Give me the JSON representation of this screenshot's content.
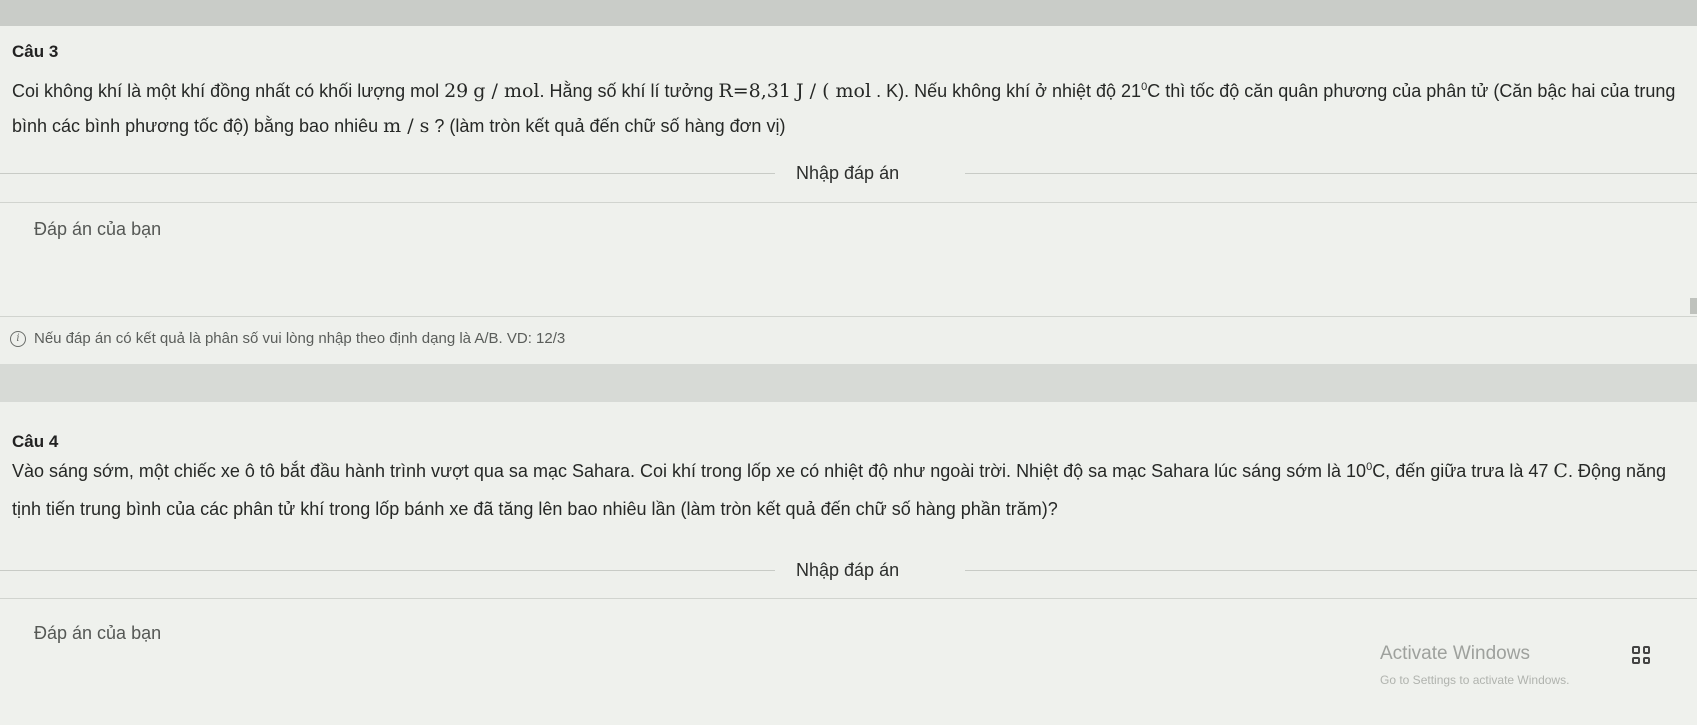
{
  "questions": [
    {
      "title": "Câu 3",
      "text_a": "Coi không khí là một khí đồng nhất có khối lượng mol ",
      "mass": "29",
      "mass_unit": "g / mol",
      "text_b": ". Hằng số khí lí tưởng ",
      "r_symbol": "R",
      "r_value": "=8,31",
      "r_unit": "J / ( mol",
      "text_c": " . K). Nếu không khí ở nhiệt độ ",
      "temp": "21",
      "temp_sup": "0",
      "temp_unit": "C thì tốc độ căn quân phương của phân tử (Căn bậc hai của trung bình các bình phương tốc độ) bằng bao nhiêu ",
      "speed_unit": "m / s",
      "text_d": " ? (làm tròn kết quả đến chữ số hàng đơn vị)",
      "section_label": "Nhập đáp án",
      "answer_placeholder": "Đáp án của bạn",
      "hint": "Nếu đáp án có kết quả là phân số vui lòng nhập theo định dạng là A/B. VD: 12/3"
    },
    {
      "title": "Câu 4",
      "text_a": "Vào sáng sớm, một chiếc xe ô tô bắt đầu hành trình vượt qua sa mạc Sahara. Coi khí trong lốp xe có nhiệt độ như ngoài trời. Nhiệt độ sa mạc Sahara lúc sáng sớm là ",
      "temp1": "10",
      "temp1_sup": "0",
      "temp1_unit": "C, đến giữa trưa là ",
      "temp2": "47",
      "temp2_unit": "C",
      "text_b": ". Động năng tịnh tiến trung bình của các phân tử khí trong lốp bánh xe đã tăng lên bao nhiêu lần (làm tròn kết quả đến chữ số hàng phần trăm)?",
      "section_label": "Nhập đáp án",
      "answer_placeholder": "Đáp án của bạn"
    }
  ],
  "watermark": {
    "title": "Activate Windows",
    "subtitle": "Go to Settings to activate Windows."
  }
}
